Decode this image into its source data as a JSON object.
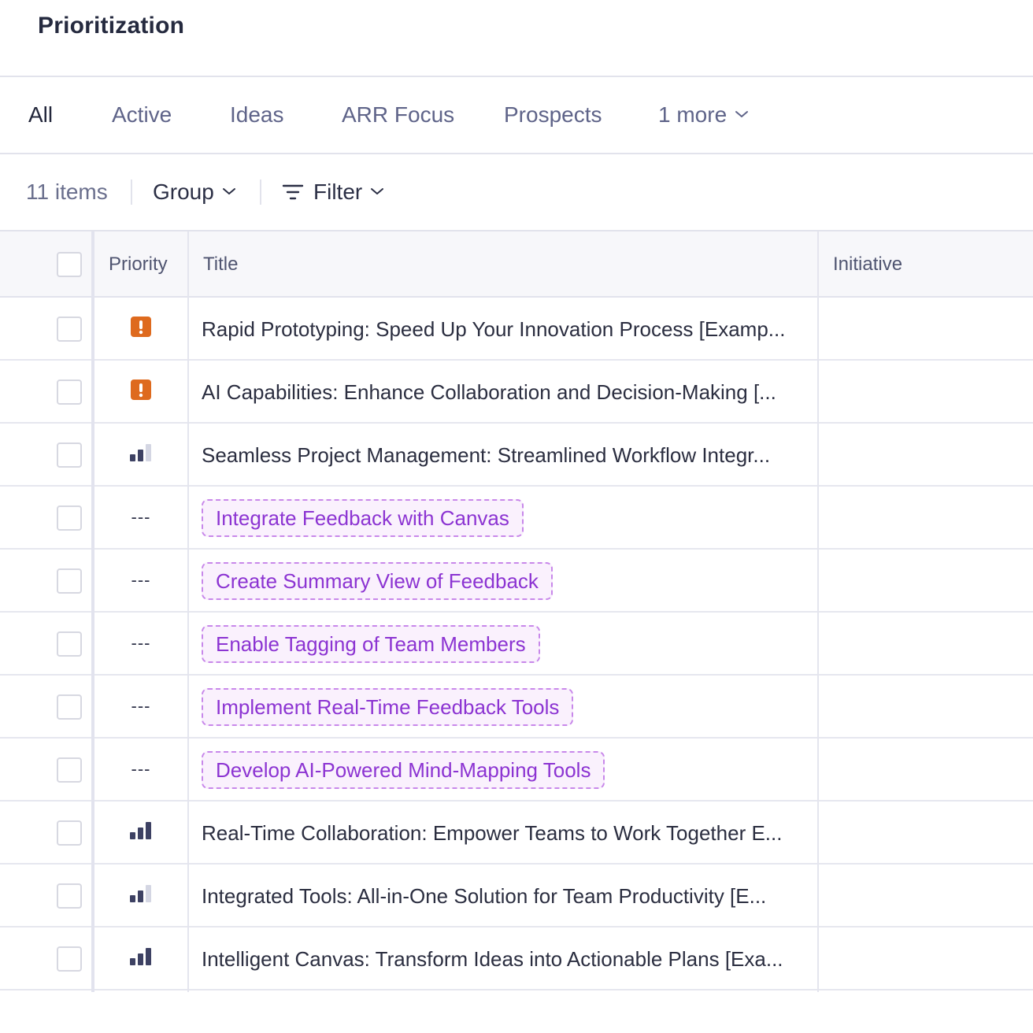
{
  "page": {
    "title": "Prioritization"
  },
  "tabs": [
    {
      "label": "All",
      "selected": true
    },
    {
      "label": "Active"
    },
    {
      "label": "Ideas"
    },
    {
      "label": "ARR Focus"
    },
    {
      "label": "Prospects"
    },
    {
      "label": "1 more"
    }
  ],
  "toolbar": {
    "count": "11 items",
    "group_label": "Group",
    "filter_label": "Filter"
  },
  "table": {
    "columns": {
      "priority": "Priority",
      "title": "Title",
      "initiative": "Initiative"
    },
    "rows": [
      {
        "priority": "urgent",
        "title": "Rapid Prototyping: Speed Up Your Innovation Process [Examp...",
        "type": "feature"
      },
      {
        "priority": "urgent",
        "title": "AI Capabilities: Enhance Collaboration and Decision-Making [...",
        "type": "feature"
      },
      {
        "priority": "medium",
        "title": "Seamless Project Management: Streamlined Workflow Integr...",
        "type": "feature"
      },
      {
        "priority": "---",
        "title": "Integrate Feedback with Canvas",
        "type": "idea"
      },
      {
        "priority": "---",
        "title": "Create Summary View of Feedback",
        "type": "idea"
      },
      {
        "priority": "---",
        "title": "Enable Tagging of Team Members",
        "type": "idea"
      },
      {
        "priority": "---",
        "title": "Implement Real-Time Feedback Tools",
        "type": "idea"
      },
      {
        "priority": "---",
        "title": "Develop AI-Powered Mind-Mapping Tools",
        "type": "idea"
      },
      {
        "priority": "high",
        "title": "Real-Time Collaboration: Empower Teams to Work Together E...",
        "type": "feature"
      },
      {
        "priority": "medium",
        "title": "Integrated Tools: All-in-One Solution for Team Productivity [E...",
        "type": "feature"
      },
      {
        "priority": "high",
        "title": "Intelligent Canvas: Transform Ideas into Actionable Plans [Exa...",
        "type": "feature"
      }
    ]
  },
  "colors": {
    "urgent": "#de6a1e",
    "bar_active": "#3d4163",
    "bar_inactive": "#d4d6e3",
    "idea_text": "#8c34d2",
    "idea_bg": "#faf1fd",
    "idea_border": "#c888ea"
  },
  "icons": {
    "urgent": "exclamation-square-icon",
    "bars": "signal-bars-icon",
    "filter": "filter-lines-icon",
    "chevron": "chevron-down-icon"
  }
}
